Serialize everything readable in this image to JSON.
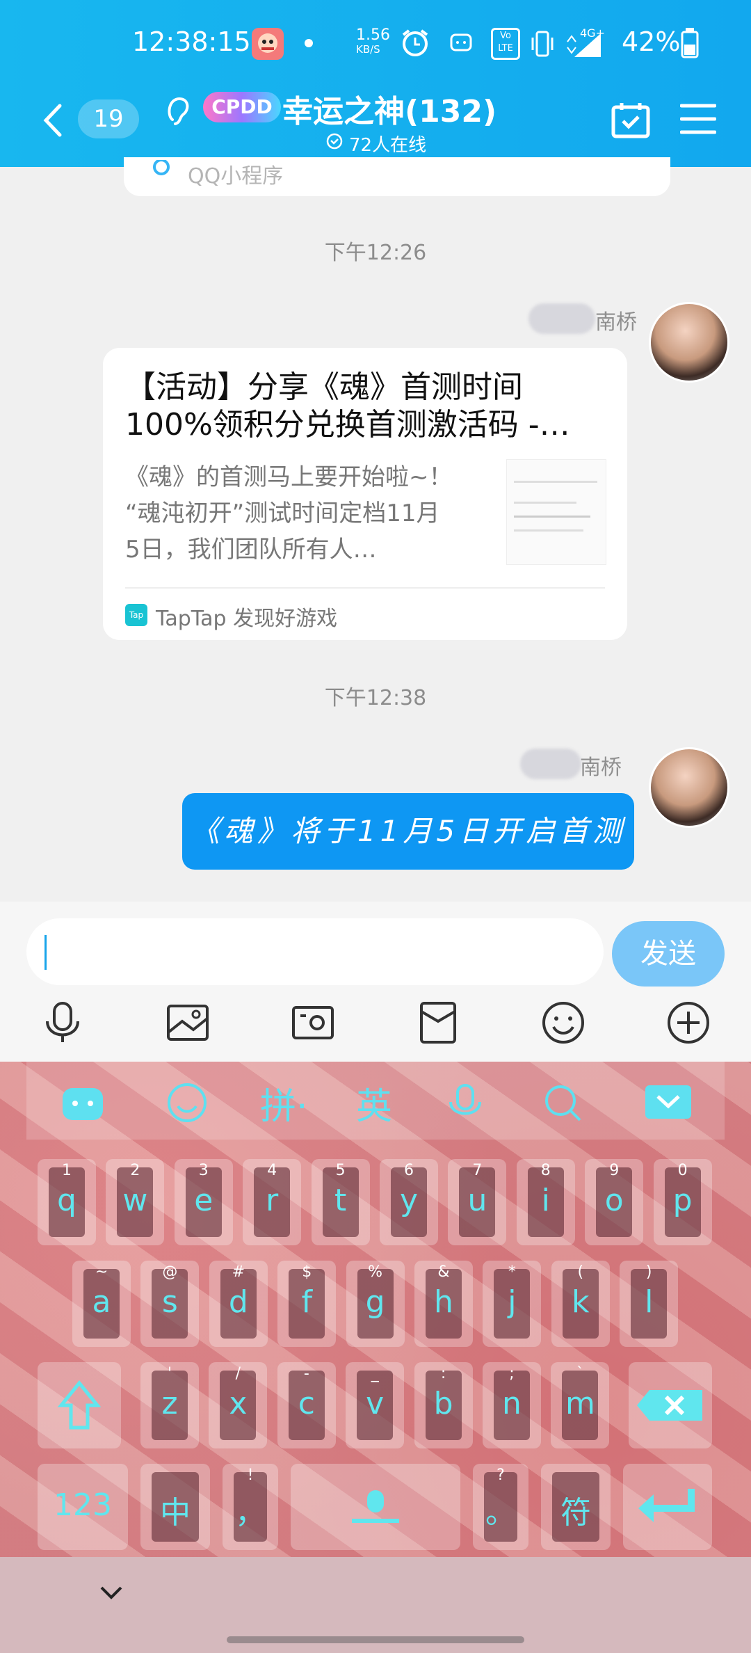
{
  "status": {
    "time": "12:38:15",
    "speed_value": "1.56",
    "speed_unit": "KB/S",
    "battery": "42%",
    "network": "4G+",
    "volte": "Vo LTE"
  },
  "header": {
    "unread_count": "19",
    "logo_text": "CPDD",
    "group_title": "幸运之神(132)",
    "online": "72人在线"
  },
  "chat": {
    "mini_program_label": "QQ小程序",
    "time1": "下午12:26",
    "sender1": "南桥",
    "card": {
      "title_line1": "【活动】分享《魂》首测时间",
      "title_line2": "100%领积分兑换首测激活码 -…",
      "desc_line1": "《魂》的首测马上要开始啦~！",
      "desc_line2": "“魂沌初开”测试时间定档11月",
      "desc_line3": "5日，我们团队所有人…",
      "source_icon": "Tap",
      "source": "TapTap 发现好游戏"
    },
    "time2": "下午12:38",
    "sender2": "南桥",
    "message": "《魂》将于11月5日开启首测"
  },
  "input": {
    "placeholder": "",
    "send_label": "发送"
  },
  "keyboard": {
    "toolbar": {
      "pinyin": "拼·",
      "english": "英"
    },
    "row1": [
      {
        "k": "q",
        "h": "1"
      },
      {
        "k": "w",
        "h": "2"
      },
      {
        "k": "e",
        "h": "3"
      },
      {
        "k": "r",
        "h": "4"
      },
      {
        "k": "t",
        "h": "5"
      },
      {
        "k": "y",
        "h": "6"
      },
      {
        "k": "u",
        "h": "7"
      },
      {
        "k": "i",
        "h": "8"
      },
      {
        "k": "o",
        "h": "9"
      },
      {
        "k": "p",
        "h": "0"
      }
    ],
    "row2": [
      {
        "k": "a",
        "h": "~"
      },
      {
        "k": "s",
        "h": "@"
      },
      {
        "k": "d",
        "h": "#"
      },
      {
        "k": "f",
        "h": "$"
      },
      {
        "k": "g",
        "h": "%"
      },
      {
        "k": "h",
        "h": "&"
      },
      {
        "k": "j",
        "h": "*"
      },
      {
        "k": "k",
        "h": "("
      },
      {
        "k": "l",
        "h": ")"
      }
    ],
    "row3": [
      {
        "k": "z",
        "h": "'"
      },
      {
        "k": "x",
        "h": "/"
      },
      {
        "k": "c",
        "h": "-"
      },
      {
        "k": "v",
        "h": "_"
      },
      {
        "k": "b",
        "h": ":"
      },
      {
        "k": "n",
        "h": ";"
      },
      {
        "k": "m",
        "h": "`"
      }
    ],
    "num_label": "123",
    "zh_label": "中",
    "comma_label": "，",
    "comma_hint": "!",
    "period_label": "。",
    "period_hint": "?",
    "symbol_label": "符"
  },
  "colors": {
    "header": "#16b1ef",
    "bubble": "#0e97f3",
    "send": "#7ac6f8",
    "key_text": "#60e6ee"
  }
}
